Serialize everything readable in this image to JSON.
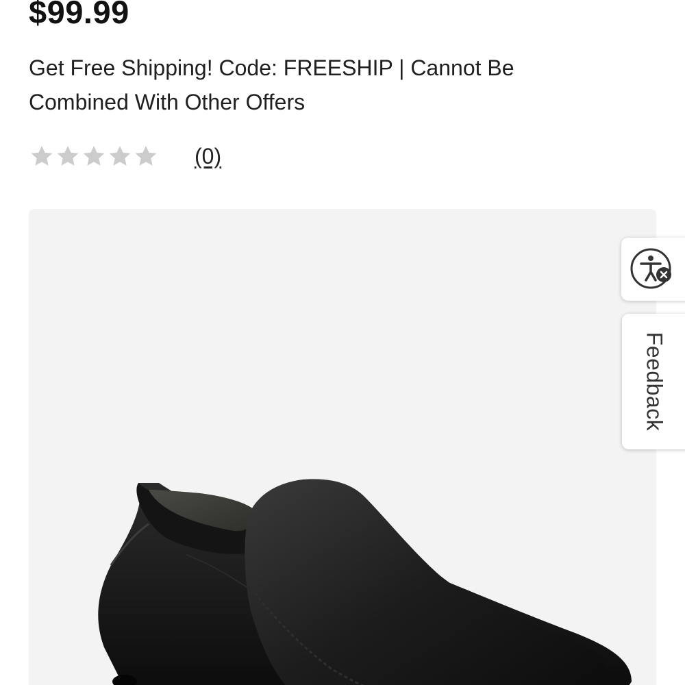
{
  "product": {
    "price": "$99.99",
    "promo_text": "Get Free Shipping! Code: FREESHIP | Cannot Be Combined With Other Offers",
    "rating": {
      "value": 0,
      "max": 5,
      "review_count_label": "(0)",
      "star_color": "#cccccc"
    },
    "image": {
      "icon": "loafer-shoe-image",
      "background": "#f3f3f3"
    }
  },
  "side_tabs": {
    "accessibility": {
      "icon": "accessibility-icon"
    },
    "feedback": {
      "label": "Feedback"
    }
  }
}
